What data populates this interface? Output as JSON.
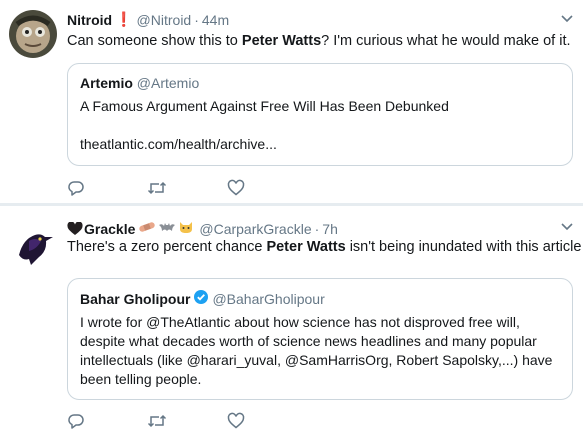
{
  "tweets": [
    {
      "name": "Nitroid",
      "name_badge": "❗",
      "handle": "@Nitroid",
      "time": "44m",
      "text_before": "Can someone show this to ",
      "text_bold": "Peter Watts",
      "text_after": "? I'm curious what he would make of it.",
      "quote": {
        "name": "Artemio",
        "handle": "@Artemio",
        "text": "A Famous Argument Against Free Will Has Been Debunked",
        "link": "theatlantic.com/health/archive..."
      }
    },
    {
      "name": "Grackle",
      "handle": "@CarparkGrackle",
      "time": "7h",
      "text_before": "There's a zero percent chance ",
      "text_bold": "Peter Watts",
      "text_after": " isn't being inundated with this article",
      "quote": {
        "name": "Bahar Gholipour",
        "handle": "@BaharGholipour",
        "text": "I wrote for @TheAtlantic about how science has not disproved free will, despite what decades worth of science news headlines and many popular intellectuals (like @harari_yuval, @SamHarrisOrg, Robert Sapolsky,...) have been telling people."
      }
    }
  ],
  "separator": "·",
  "icons": {
    "reply": "reply-icon",
    "retweet": "retweet-icon",
    "like": "like-icon",
    "caret": "chevron-down-icon",
    "verified": "verified-badge-icon"
  },
  "colors": {
    "icon_gray": "#657786",
    "verified_blue": "#1da1f2",
    "badge_red": "#e0245e",
    "divider": "#e6ecf0",
    "border": "#ccd6dd"
  }
}
